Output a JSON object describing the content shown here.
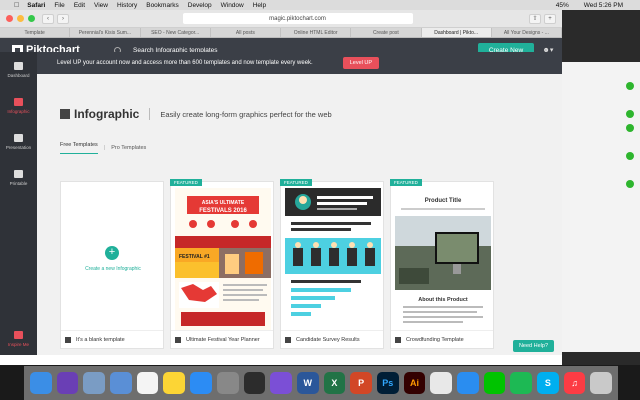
{
  "menubar": {
    "app": "Safari",
    "items": [
      "File",
      "Edit",
      "View",
      "History",
      "Bookmarks",
      "Develop",
      "Window",
      "Help"
    ],
    "battery": "45%",
    "clock": "Wed 5:26 PM"
  },
  "browser": {
    "address": "magic.piktochart.com",
    "tabs": [
      "Template",
      "Perennial's Kisis Sum...",
      "SEO - New Categor...",
      "All posts",
      "Online HTML Editor",
      "Create post",
      "Dashboard | Pikto...",
      "All Your Designs - ..."
    ],
    "active_tab_index": 6
  },
  "header": {
    "logo": "Piktochart",
    "search_placeholder": "Search Infographic templates",
    "create_button": "Create New"
  },
  "sidebar": {
    "items": [
      {
        "label": "Dashboard",
        "icon": "dashboard-icon"
      },
      {
        "label": "Infographic",
        "icon": "infographic-icon"
      },
      {
        "label": "Presentation",
        "icon": "presentation-icon"
      },
      {
        "label": "Printable",
        "icon": "printable-icon"
      }
    ],
    "active_index": 1,
    "bottom_label": "Inspire Me"
  },
  "banner": {
    "text": "Level UP your account now and access more than 600 templates and more than 600 templates and now template every week.",
    "button": "Level UP"
  },
  "page": {
    "title": "Infographic",
    "subtitle": "Easily create long-form graphics perfect for the web",
    "tabs": [
      "Free Templates",
      "Pro Templates"
    ],
    "active_tab": 0
  },
  "cards": [
    {
      "caption": "It's a blank template",
      "featured": false,
      "blank_label": "Create a new Infographic"
    },
    {
      "caption": "Ultimate Festival Year Planner",
      "featured": true,
      "featured_label": "FEATURED",
      "thumb_title": "ASIA'S ULTIMATE FESTIVALS 2016",
      "thumb_sub": "FESTIVAL #1"
    },
    {
      "caption": "Candidate Survey Results",
      "featured": true,
      "featured_label": "FEATURED",
      "thumb_title": "CANDIDATE SATISFACTION SURVEY RESULTS 2016",
      "thumb_q1": "1. How would you evaluate your interview experience?",
      "thumb_q2": "2. The interview process was..."
    },
    {
      "caption": "Crowdfunding Template",
      "featured": true,
      "featured_label": "FEATURED",
      "thumb_title": "Product Title",
      "thumb_sub": "About this Product"
    }
  ],
  "help_button": "Need Help?",
  "colors": {
    "accent": "#20b09a",
    "brand_dark": "#3b3f47",
    "levelup": "#e8505b"
  }
}
